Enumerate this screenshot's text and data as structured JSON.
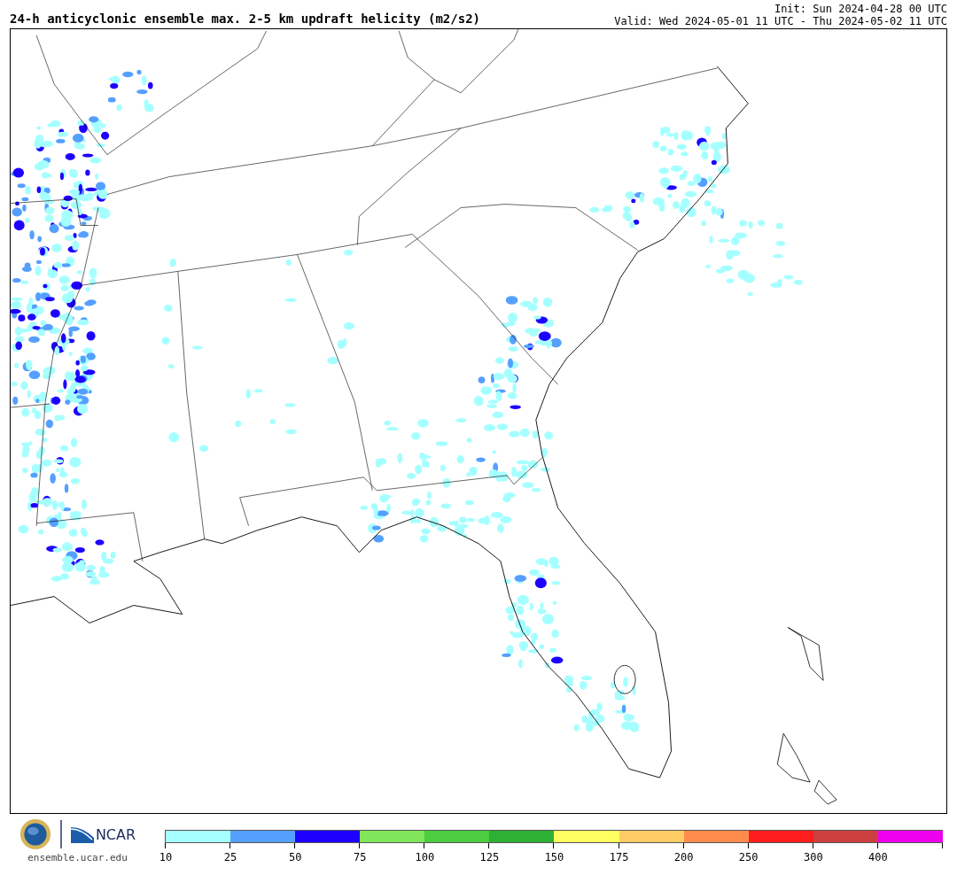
{
  "header": {
    "title": "24-h anticyclonic ensemble max. 2-5 km updraft helicity (m2/s2)",
    "init": "Init: Sun 2024-04-28 00 UTC",
    "valid": "Valid: Wed 2024-05-01 11 UTC - Thu 2024-05-02 11 UTC"
  },
  "footer": {
    "org": "NCAR",
    "website": "ensemble.ucar.edu"
  },
  "colorbar": [
    {
      "label": "10",
      "color": "#a6ffff"
    },
    {
      "label": "25",
      "color": "#55a0ff"
    },
    {
      "label": "50",
      "color": "#1e00ff"
    },
    {
      "label": "75",
      "color": "#80e65a"
    },
    {
      "label": "100",
      "color": "#4ccc40"
    },
    {
      "label": "125",
      "color": "#2eb034"
    },
    {
      "label": "150",
      "color": "#ffff60"
    },
    {
      "label": "175",
      "color": "#ffcc66"
    },
    {
      "label": "200",
      "color": "#ff8c4c"
    },
    {
      "label": "250",
      "color": "#ff1e1e"
    },
    {
      "label": "300",
      "color": "#cc4040"
    },
    {
      "label": "400",
      "color": "#ee00ee"
    }
  ]
}
